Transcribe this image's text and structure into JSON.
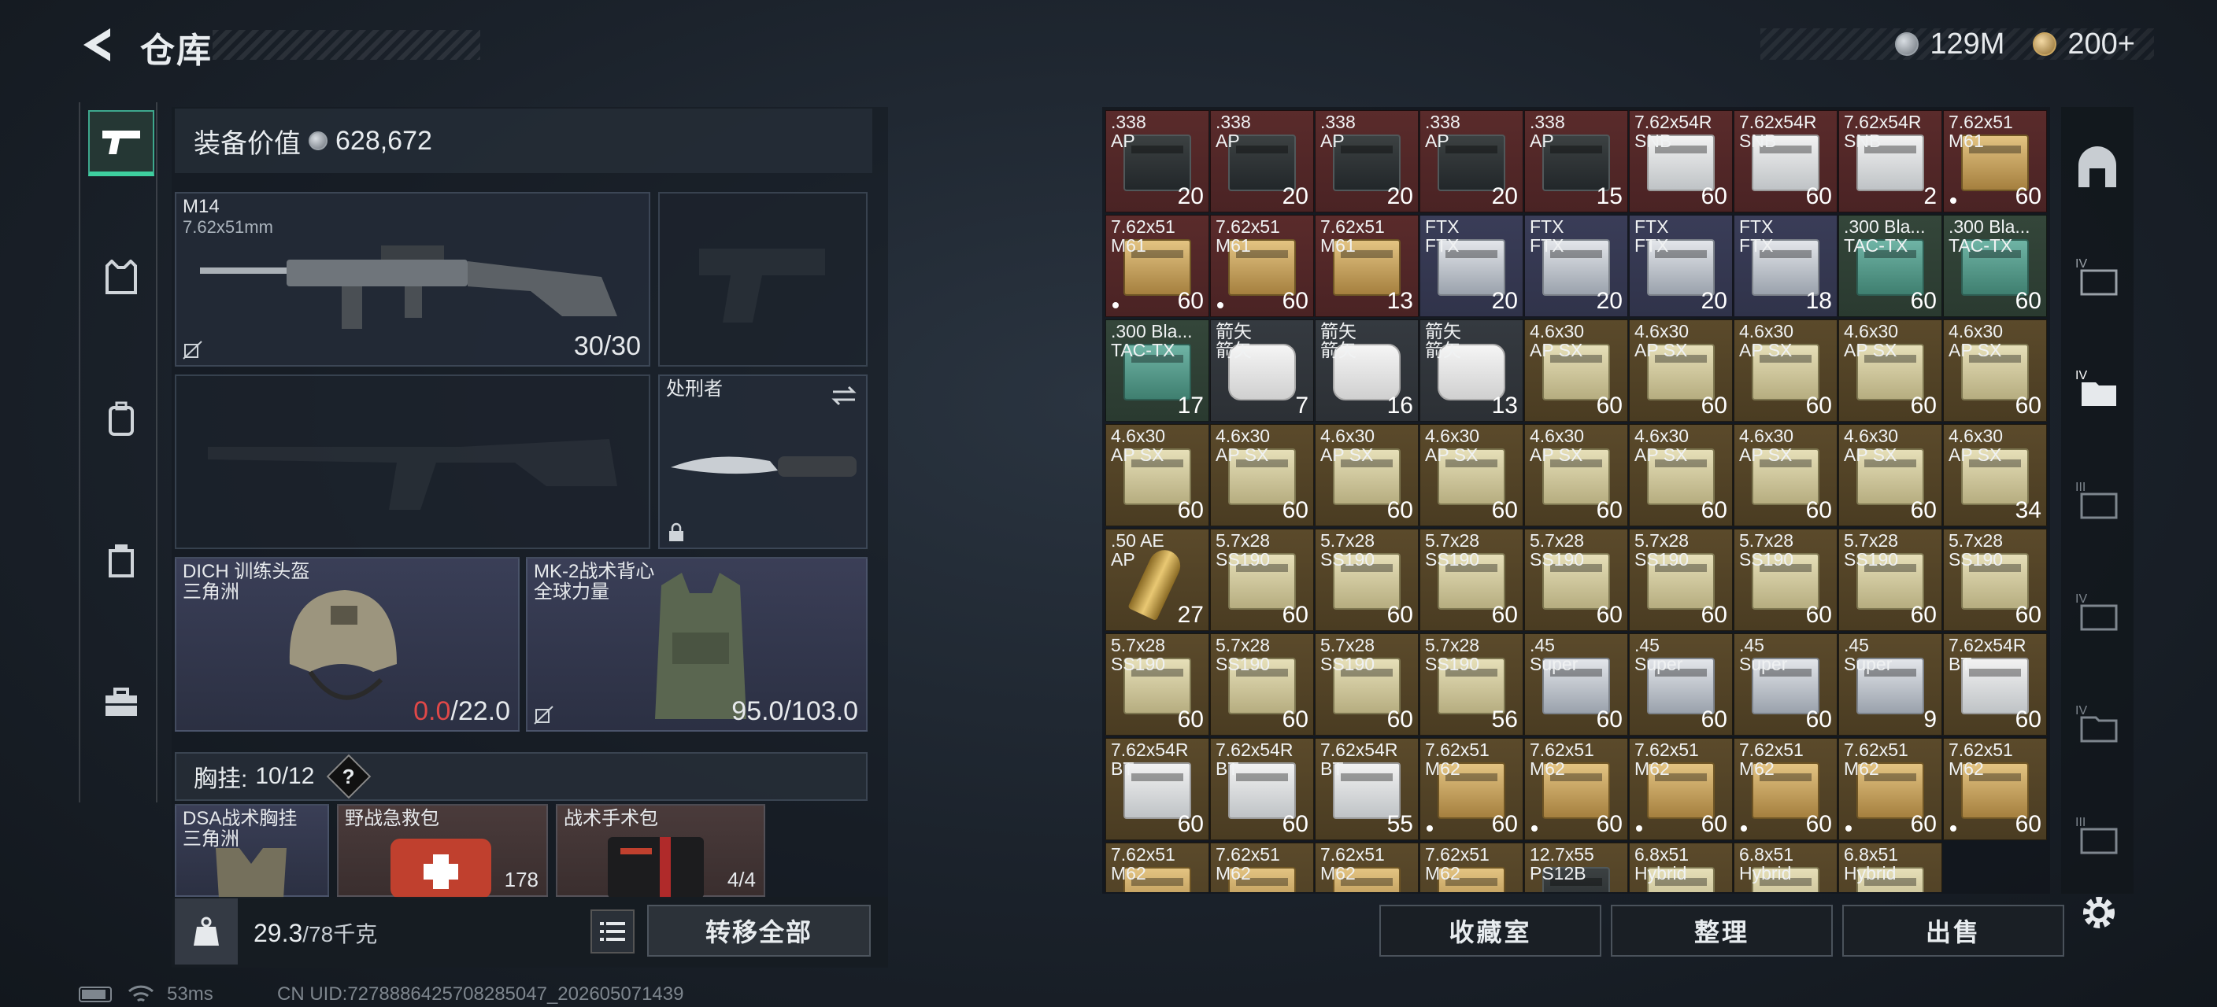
{
  "header": {
    "title": "仓库"
  },
  "currency": {
    "coins": "129M",
    "gold": "200+"
  },
  "equipment": {
    "value_label": "装备价值",
    "value": "628,672",
    "primary_weapon": {
      "name": "M14",
      "caliber": "7.62x51mm",
      "ammo": "30/30"
    },
    "melee": {
      "name": "处刑者"
    },
    "helmet": {
      "name": "DICH 训练头盔",
      "faction": "三角洲",
      "durability_current": "0.0",
      "durability_max": "/22.0"
    },
    "armor": {
      "name": "MK-2战术背心",
      "faction": "全球力量",
      "durability": "95.0/103.0"
    },
    "vest": {
      "label": "胸挂:",
      "capacity": "10/12",
      "help": "?"
    },
    "vest_items": [
      {
        "name": "DSA战术胸挂",
        "sub": "三角洲",
        "count": ""
      },
      {
        "name": "野战急救包",
        "sub": "",
        "count": "178"
      },
      {
        "name": "战术手术包",
        "sub": "",
        "count": "4/4"
      }
    ],
    "weight_current": "29.3",
    "weight_max": "/78千克",
    "transfer_all": "转移全部"
  },
  "stash": {
    "cells": [
      {
        "label": ".338\nAP",
        "count": "20",
        "color": "red",
        "box": "dark",
        "dot": false
      },
      {
        "label": ".338\nAP",
        "count": "20",
        "color": "red",
        "box": "dark",
        "dot": false
      },
      {
        "label": ".338\nAP",
        "count": "20",
        "color": "red",
        "box": "dark",
        "dot": false
      },
      {
        "label": ".338\nAP",
        "count": "20",
        "color": "red",
        "box": "dark",
        "dot": false
      },
      {
        "label": ".338\nAP",
        "count": "15",
        "color": "red",
        "box": "dark",
        "dot": false
      },
      {
        "label": "7.62x54R\nSNB",
        "count": "60",
        "color": "red",
        "box": "white",
        "dot": false
      },
      {
        "label": "7.62x54R\nSNB",
        "count": "60",
        "color": "red",
        "box": "white",
        "dot": false
      },
      {
        "label": "7.62x54R\nSNB",
        "count": "2",
        "color": "red",
        "box": "white",
        "dot": false
      },
      {
        "label": "7.62x51\nM61",
        "count": "60",
        "color": "red",
        "box": "yellow",
        "dot": true
      },
      {
        "label": "7.62x51\nM61",
        "count": "60",
        "color": "red",
        "box": "yellow",
        "dot": true
      },
      {
        "label": "7.62x51\nM61",
        "count": "60",
        "color": "red",
        "box": "yellow",
        "dot": true
      },
      {
        "label": "7.62x51\nM61",
        "count": "13",
        "color": "red",
        "box": "yellow",
        "dot": false
      },
      {
        "label": "FTX\nFTX",
        "count": "20",
        "color": "blue",
        "box": "silver",
        "dot": false
      },
      {
        "label": "FTX\nFTX",
        "count": "20",
        "color": "blue",
        "box": "silver",
        "dot": false
      },
      {
        "label": "FTX\nFTX",
        "count": "20",
        "color": "blue",
        "box": "silver",
        "dot": false
      },
      {
        "label": "FTX\nFTX",
        "count": "18",
        "color": "blue",
        "box": "silver",
        "dot": false
      },
      {
        "label": ".300 Bla...\nTAC-TX",
        "count": "60",
        "color": "green",
        "box": "teal",
        "dot": false
      },
      {
        "label": ".300 Bla...\nTAC-TX",
        "count": "60",
        "color": "green",
        "box": "teal",
        "dot": false
      },
      {
        "label": ".300 Bla...\nTAC-TX",
        "count": "17",
        "color": "green",
        "box": "teal",
        "dot": false
      },
      {
        "label": "箭矢\n箭矢",
        "count": "7",
        "color": "gray",
        "box": "arrow",
        "dot": false
      },
      {
        "label": "箭矢\n箭矢",
        "count": "16",
        "color": "gray",
        "box": "arrow",
        "dot": false
      },
      {
        "label": "箭矢\n箭矢",
        "count": "13",
        "color": "gray",
        "box": "arrow",
        "dot": false
      },
      {
        "label": "4.6x30\nAP SX",
        "count": "60",
        "color": "gold",
        "box": "cream",
        "dot": false
      },
      {
        "label": "4.6x30\nAP SX",
        "count": "60",
        "color": "gold",
        "box": "cream",
        "dot": false
      },
      {
        "label": "4.6x30\nAP SX",
        "count": "60",
        "color": "gold",
        "box": "cream",
        "dot": false
      },
      {
        "label": "4.6x30\nAP SX",
        "count": "60",
        "color": "gold",
        "box": "cream",
        "dot": false
      },
      {
        "label": "4.6x30\nAP SX",
        "count": "60",
        "color": "gold",
        "box": "cream",
        "dot": false
      },
      {
        "label": "4.6x30\nAP SX",
        "count": "60",
        "color": "gold",
        "box": "cream",
        "dot": false
      },
      {
        "label": "4.6x30\nAP SX",
        "count": "60",
        "color": "gold",
        "box": "cream",
        "dot": false
      },
      {
        "label": "4.6x30\nAP SX",
        "count": "60",
        "color": "gold",
        "box": "cream",
        "dot": false
      },
      {
        "label": "4.6x30\nAP SX",
        "count": "60",
        "color": "gold",
        "box": "cream",
        "dot": false
      },
      {
        "label": "4.6x30\nAP SX",
        "count": "60",
        "color": "gold",
        "box": "cream",
        "dot": false
      },
      {
        "label": "4.6x30\nAP SX",
        "count": "60",
        "color": "gold",
        "box": "cream",
        "dot": false
      },
      {
        "label": "4.6x30\nAP SX",
        "count": "60",
        "color": "gold",
        "box": "cream",
        "dot": false
      },
      {
        "label": "4.6x30\nAP SX",
        "count": "60",
        "color": "gold",
        "box": "cream",
        "dot": false
      },
      {
        "label": "4.6x30\nAP SX",
        "count": "34",
        "color": "gold",
        "box": "cream",
        "dot": false
      },
      {
        "label": ".50 AE\nAP",
        "count": "27",
        "color": "gold",
        "box": "bullet",
        "dot": false
      },
      {
        "label": "5.7x28\nSS190",
        "count": "60",
        "color": "gold",
        "box": "cream",
        "dot": false
      },
      {
        "label": "5.7x28\nSS190",
        "count": "60",
        "color": "gold",
        "box": "cream",
        "dot": false
      },
      {
        "label": "5.7x28\nSS190",
        "count": "60",
        "color": "gold",
        "box": "cream",
        "dot": false
      },
      {
        "label": "5.7x28\nSS190",
        "count": "60",
        "color": "gold",
        "box": "cream",
        "dot": false
      },
      {
        "label": "5.7x28\nSS190",
        "count": "60",
        "color": "gold",
        "box": "cream",
        "dot": false
      },
      {
        "label": "5.7x28\nSS190",
        "count": "60",
        "color": "gold",
        "box": "cream",
        "dot": false
      },
      {
        "label": "5.7x28\nSS190",
        "count": "60",
        "color": "gold",
        "box": "cream",
        "dot": false
      },
      {
        "label": "5.7x28\nSS190",
        "count": "60",
        "color": "gold",
        "box": "cream",
        "dot": false
      },
      {
        "label": "5.7x28\nSS190",
        "count": "60",
        "color": "gold",
        "box": "cream",
        "dot": false
      },
      {
        "label": "5.7x28\nSS190",
        "count": "60",
        "color": "gold",
        "box": "cream",
        "dot": false
      },
      {
        "label": "5.7x28\nSS190",
        "count": "60",
        "color": "gold",
        "box": "cream",
        "dot": false
      },
      {
        "label": "5.7x28\nSS190",
        "count": "56",
        "color": "gold",
        "box": "cream",
        "dot": false
      },
      {
        "label": ".45\nSuper",
        "count": "60",
        "color": "gold",
        "box": "silver",
        "dot": false
      },
      {
        "label": ".45\nSuper",
        "count": "60",
        "color": "gold",
        "box": "silver",
        "dot": false
      },
      {
        "label": ".45\nSuper",
        "count": "60",
        "color": "gold",
        "box": "silver",
        "dot": false
      },
      {
        "label": ".45\nSuper",
        "count": "9",
        "color": "gold",
        "box": "silver",
        "dot": false
      },
      {
        "label": "7.62x54R\nBT",
        "count": "60",
        "color": "gold",
        "box": "white",
        "dot": false
      },
      {
        "label": "7.62x54R\nBT",
        "count": "60",
        "color": "gold",
        "box": "white",
        "dot": false
      },
      {
        "label": "7.62x54R\nBT",
        "count": "60",
        "color": "gold",
        "box": "white",
        "dot": false
      },
      {
        "label": "7.62x54R\nBT",
        "count": "55",
        "color": "gold",
        "box": "white",
        "dot": false
      },
      {
        "label": "7.62x51\nM62",
        "count": "60",
        "color": "gold",
        "box": "yellow",
        "dot": true
      },
      {
        "label": "7.62x51\nM62",
        "count": "60",
        "color": "gold",
        "box": "yellow",
        "dot": true
      },
      {
        "label": "7.62x51\nM62",
        "count": "60",
        "color": "gold",
        "box": "yellow",
        "dot": true
      },
      {
        "label": "7.62x51\nM62",
        "count": "60",
        "color": "gold",
        "box": "yellow",
        "dot": true
      },
      {
        "label": "7.62x51\nM62",
        "count": "60",
        "color": "gold",
        "box": "yellow",
        "dot": true
      },
      {
        "label": "7.62x51\nM62",
        "count": "60",
        "color": "gold",
        "box": "yellow",
        "dot": true
      },
      {
        "label": "7.62x51\nM62",
        "count": "",
        "color": "gold",
        "box": "yellow",
        "dot": false
      },
      {
        "label": "7.62x51\nM62",
        "count": "",
        "color": "gold",
        "box": "yellow",
        "dot": false
      },
      {
        "label": "7.62x51\nM62",
        "count": "",
        "color": "gold",
        "box": "yellow",
        "dot": false
      },
      {
        "label": "7.62x51\nM62",
        "count": "",
        "color": "gold",
        "box": "yellow",
        "dot": false
      },
      {
        "label": "12.7x55\nPS12B",
        "count": "",
        "color": "gold",
        "box": "dark",
        "dot": false
      },
      {
        "label": "6.8x51\nHybrid",
        "count": "",
        "color": "gold",
        "box": "cream",
        "dot": false
      },
      {
        "label": "6.8x51\nHybrid",
        "count": "",
        "color": "gold",
        "box": "cream",
        "dot": false
      },
      {
        "label": "6.8x51\nHybrid",
        "count": "",
        "color": "gold",
        "box": "cream",
        "dot": false
      }
    ]
  },
  "actions": {
    "collection": "收藏室",
    "organize": "整理",
    "sell": "出售"
  },
  "status": {
    "ping": "53ms",
    "uid": "CN UID:7278886425708285047_202605071439"
  }
}
